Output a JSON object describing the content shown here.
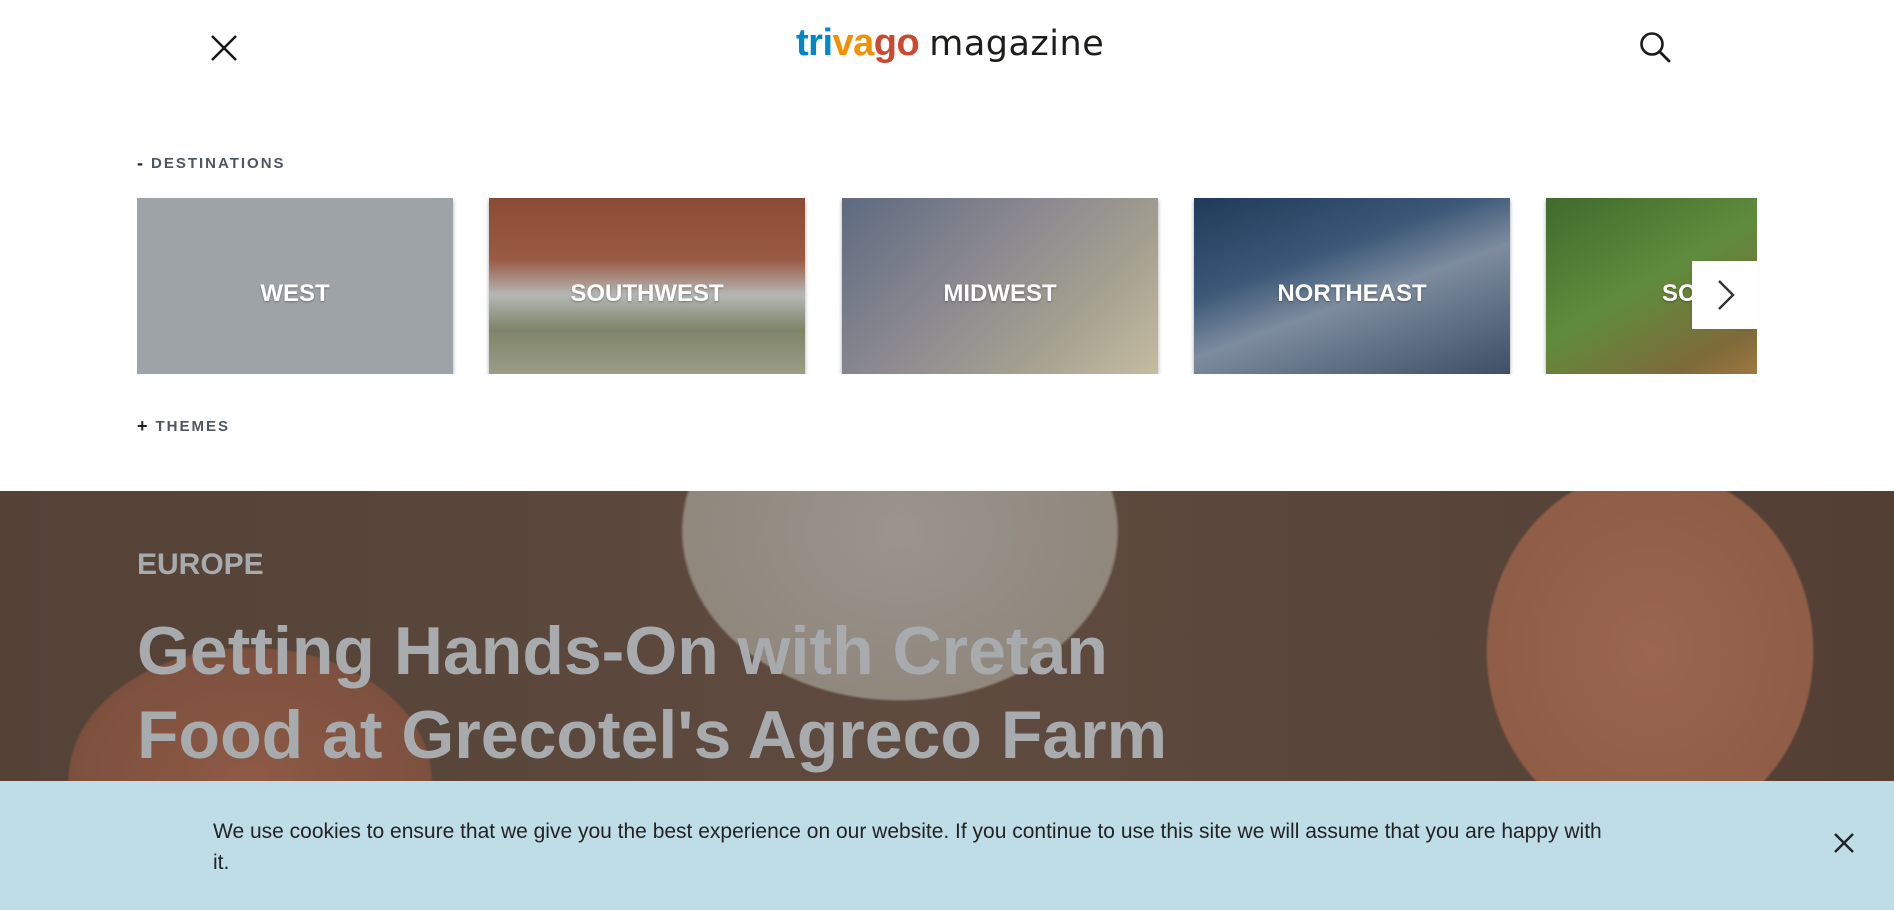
{
  "header": {
    "logo_brand": "trivago",
    "logo_suffix": "magazine",
    "brand_colors": [
      "#0088c8",
      "#f48f00",
      "#c94a30"
    ]
  },
  "menu": {
    "destinations": {
      "sign": "-",
      "label": "DESTINATIONS"
    },
    "themes": {
      "sign": "+",
      "label": "THEMES"
    },
    "cards": [
      {
        "label": "WEST"
      },
      {
        "label": "SOUTHWEST"
      },
      {
        "label": "MIDWEST"
      },
      {
        "label": "NORTHEAST"
      },
      {
        "label": "SOUTH"
      }
    ]
  },
  "hero": {
    "kicker": "EUROPE",
    "headline": "Getting Hands-On with Cretan Food at Grecotel's Agreco Farm"
  },
  "cookie": {
    "message": "We use cookies to ensure that we give you the best experience on our website. If you continue to use this site we will assume that you are happy with it."
  },
  "icons": {
    "close": "close-icon",
    "search": "search-icon",
    "next": "chevron-right-icon"
  }
}
